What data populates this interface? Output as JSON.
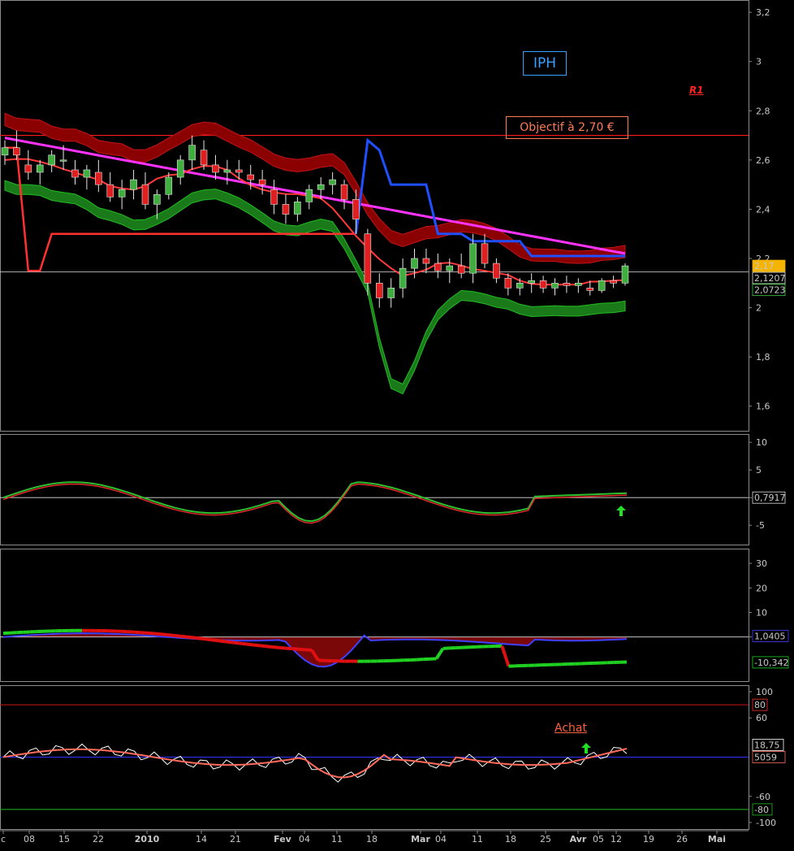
{
  "annotations": {
    "ticker": "IPH",
    "objective": "Objectif à 2,70 €",
    "resistance": "R1",
    "signal": "Achat"
  },
  "colors": {
    "background": "#000000",
    "up_candle": "#3fae3f",
    "down_candle": "#e02020",
    "upper_band": "#8b0000",
    "lower_band": "#1a7a1a",
    "ma_long": "#ff33ff",
    "trailing_stop": "#1e50ff",
    "support_line": "#ff3030"
  },
  "x_axis": {
    "labels": [
      "c",
      "08",
      "15",
      "22",
      "2010",
      "14",
      "21",
      "Fev",
      "04",
      "11",
      "18",
      "Mar",
      "04",
      "11",
      "18",
      "25",
      "Avr",
      "05",
      "12",
      "19",
      "26",
      "Mai"
    ]
  },
  "chart_data": [
    {
      "type": "candlestick",
      "panel": "price",
      "ylim": [
        1.5,
        3.25
      ],
      "yticks": [
        "3,2",
        "3",
        "2,8",
        "2,6",
        "2,4",
        "2,2",
        "2",
        "1,8",
        "1,6"
      ],
      "resistance_value": 2.7,
      "last_values": [
        "2,17",
        "2,1207",
        "2,0723"
      ],
      "trailing_stop_flat": 2.21,
      "ohlc": [
        [
          2.62,
          2.68,
          2.58,
          2.65
        ],
        [
          2.65,
          2.72,
          2.6,
          2.62
        ],
        [
          2.58,
          2.64,
          2.52,
          2.55
        ],
        [
          2.55,
          2.6,
          2.5,
          2.58
        ],
        [
          2.58,
          2.64,
          2.55,
          2.62
        ],
        [
          2.6,
          2.66,
          2.56,
          2.6
        ],
        [
          2.56,
          2.6,
          2.5,
          2.53
        ],
        [
          2.53,
          2.58,
          2.48,
          2.56
        ],
        [
          2.55,
          2.6,
          2.47,
          2.5
        ],
        [
          2.5,
          2.55,
          2.43,
          2.45
        ],
        [
          2.45,
          2.52,
          2.4,
          2.48
        ],
        [
          2.48,
          2.56,
          2.44,
          2.52
        ],
        [
          2.5,
          2.55,
          2.4,
          2.42
        ],
        [
          2.42,
          2.48,
          2.36,
          2.46
        ],
        [
          2.46,
          2.55,
          2.44,
          2.53
        ],
        [
          2.53,
          2.62,
          2.5,
          2.6
        ],
        [
          2.6,
          2.7,
          2.56,
          2.66
        ],
        [
          2.64,
          2.68,
          2.56,
          2.58
        ],
        [
          2.58,
          2.62,
          2.52,
          2.55
        ],
        [
          2.55,
          2.6,
          2.5,
          2.56
        ],
        [
          2.56,
          2.6,
          2.52,
          2.55
        ],
        [
          2.54,
          2.58,
          2.48,
          2.52
        ],
        [
          2.52,
          2.56,
          2.46,
          2.5
        ],
        [
          2.48,
          2.52,
          2.38,
          2.42
        ],
        [
          2.42,
          2.46,
          2.34,
          2.38
        ],
        [
          2.38,
          2.45,
          2.35,
          2.43
        ],
        [
          2.43,
          2.5,
          2.4,
          2.48
        ],
        [
          2.48,
          2.53,
          2.44,
          2.5
        ],
        [
          2.5,
          2.55,
          2.46,
          2.52
        ],
        [
          2.5,
          2.52,
          2.4,
          2.44
        ],
        [
          2.44,
          2.48,
          2.3,
          2.36
        ],
        [
          2.3,
          2.32,
          2.05,
          2.1
        ],
        [
          2.1,
          2.14,
          2.0,
          2.04
        ],
        [
          2.04,
          2.12,
          2.0,
          2.08
        ],
        [
          2.08,
          2.2,
          2.04,
          2.16
        ],
        [
          2.16,
          2.24,
          2.12,
          2.2
        ],
        [
          2.2,
          2.24,
          2.14,
          2.18
        ],
        [
          2.18,
          2.22,
          2.12,
          2.15
        ],
        [
          2.15,
          2.2,
          2.1,
          2.17
        ],
        [
          2.17,
          2.22,
          2.12,
          2.14
        ],
        [
          2.14,
          2.3,
          2.1,
          2.26
        ],
        [
          2.26,
          2.3,
          2.16,
          2.18
        ],
        [
          2.18,
          2.2,
          2.1,
          2.12
        ],
        [
          2.12,
          2.14,
          2.05,
          2.08
        ],
        [
          2.08,
          2.12,
          2.05,
          2.1
        ],
        [
          2.1,
          2.14,
          2.06,
          2.11
        ],
        [
          2.11,
          2.13,
          2.06,
          2.08
        ],
        [
          2.08,
          2.12,
          2.05,
          2.1
        ],
        [
          2.1,
          2.13,
          2.06,
          2.09
        ],
        [
          2.09,
          2.12,
          2.06,
          2.1
        ],
        [
          2.08,
          2.11,
          2.05,
          2.07
        ],
        [
          2.07,
          2.12,
          2.06,
          2.11
        ],
        [
          2.11,
          2.13,
          2.08,
          2.1
        ],
        [
          2.1,
          2.18,
          2.09,
          2.17
        ]
      ]
    },
    {
      "type": "line",
      "panel": "oscillator_1",
      "ylim": [
        -8.5,
        11.5
      ],
      "yticks": [
        "10",
        "5",
        "0",
        "-5"
      ],
      "reference": 0,
      "last_value": "0,7917"
    },
    {
      "type": "area",
      "panel": "oscillator_2",
      "ylim": [
        -18,
        36
      ],
      "yticks": [
        "30",
        "20",
        "10",
        "0"
      ],
      "reference": 0,
      "last_values": [
        "1,0405",
        "-10,342"
      ]
    },
    {
      "type": "line",
      "panel": "oscillator_3",
      "ylim": [
        -110,
        110
      ],
      "yticks": [
        "100",
        "60",
        "-60",
        "-100"
      ],
      "levels": [
        80,
        0,
        -80
      ],
      "level_labels": [
        "80",
        "-80"
      ],
      "last_values": [
        "18,75",
        "5059"
      ]
    }
  ]
}
